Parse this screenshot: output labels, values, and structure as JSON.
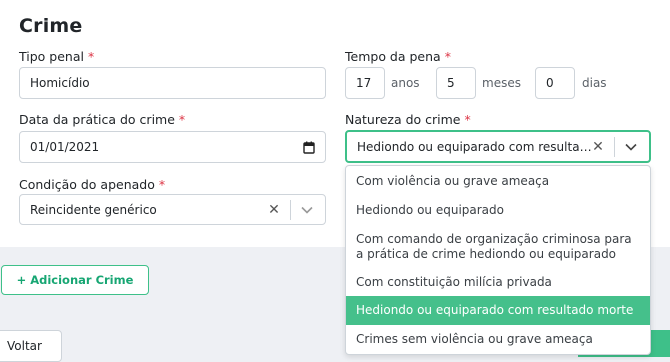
{
  "section_title": "Crime",
  "tipo_penal": {
    "label": "Tipo penal",
    "value": "Homicídio"
  },
  "tempo_pena": {
    "label": "Tempo da pena",
    "anos_value": "17",
    "anos_label": "anos",
    "meses_value": "5",
    "meses_label": "meses",
    "dias_value": "0",
    "dias_label": "dias"
  },
  "data_pratica": {
    "label": "Data da prática do crime",
    "value": "01/01/2021"
  },
  "natureza": {
    "label": "Natureza do crime",
    "value": "Hediondo ou equiparado com resultado mo...",
    "options": [
      "Com violência ou grave ameaça",
      "Hediondo ou equiparado",
      "Com comando de organização criminosa para a prática de crime hediondo ou equiparado",
      "Com constituição milícia privada",
      "Hediondo ou equiparado com resultado morte",
      "Crimes sem violência ou grave ameaça"
    ],
    "selected_index": 4
  },
  "condicao": {
    "label": "Condição do apenado",
    "value": "Reincidente genérico"
  },
  "required_mark": "*",
  "buttons": {
    "add_crime": "+ Adicionar Crime",
    "back": "Voltar"
  },
  "colors": {
    "accent": "#3ec089",
    "selected_option": "#45c08b",
    "required": "#dc3545"
  }
}
